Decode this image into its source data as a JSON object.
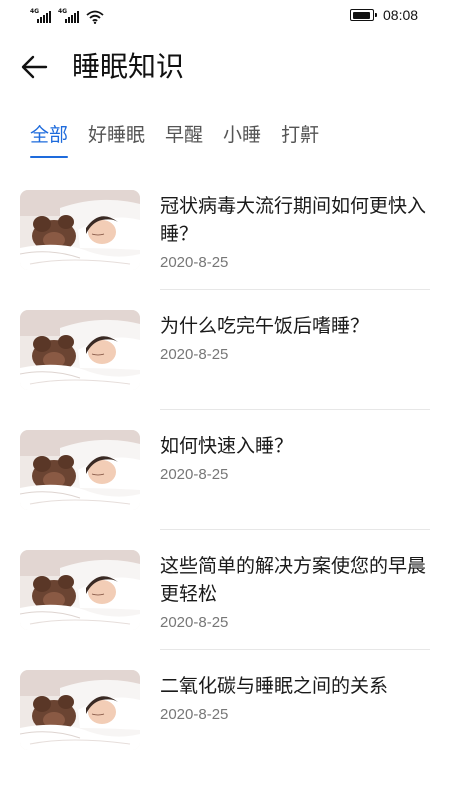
{
  "status_bar": {
    "sim1_net": "4G",
    "sim2_net": "4G",
    "time": "08:08",
    "icons": [
      "signal-icon",
      "signal-icon",
      "wifi-icon",
      "battery-icon"
    ]
  },
  "header": {
    "title": "睡眠知识",
    "back_icon": "arrow-left-icon"
  },
  "tabs": [
    {
      "label": "全部",
      "active": true
    },
    {
      "label": "好睡眠",
      "active": false
    },
    {
      "label": "早醒",
      "active": false
    },
    {
      "label": "小睡",
      "active": false
    },
    {
      "label": "打鼾",
      "active": false
    }
  ],
  "accent_color": "#1e6bdc",
  "articles": [
    {
      "title": "冠状病毒大流行期间如何更快入睡？",
      "date": "2020-8-25"
    },
    {
      "title": "为什么吃完午饭后嗜睡？",
      "date": "2020-8-25"
    },
    {
      "title": "如何快速入睡？",
      "date": "2020-8-25"
    },
    {
      "title": "这些简单的解决方案使您的早晨更轻松",
      "date": "2020-8-25"
    },
    {
      "title": "二氧化碳与睡眠之间的关系",
      "date": "2020-8-25"
    }
  ]
}
